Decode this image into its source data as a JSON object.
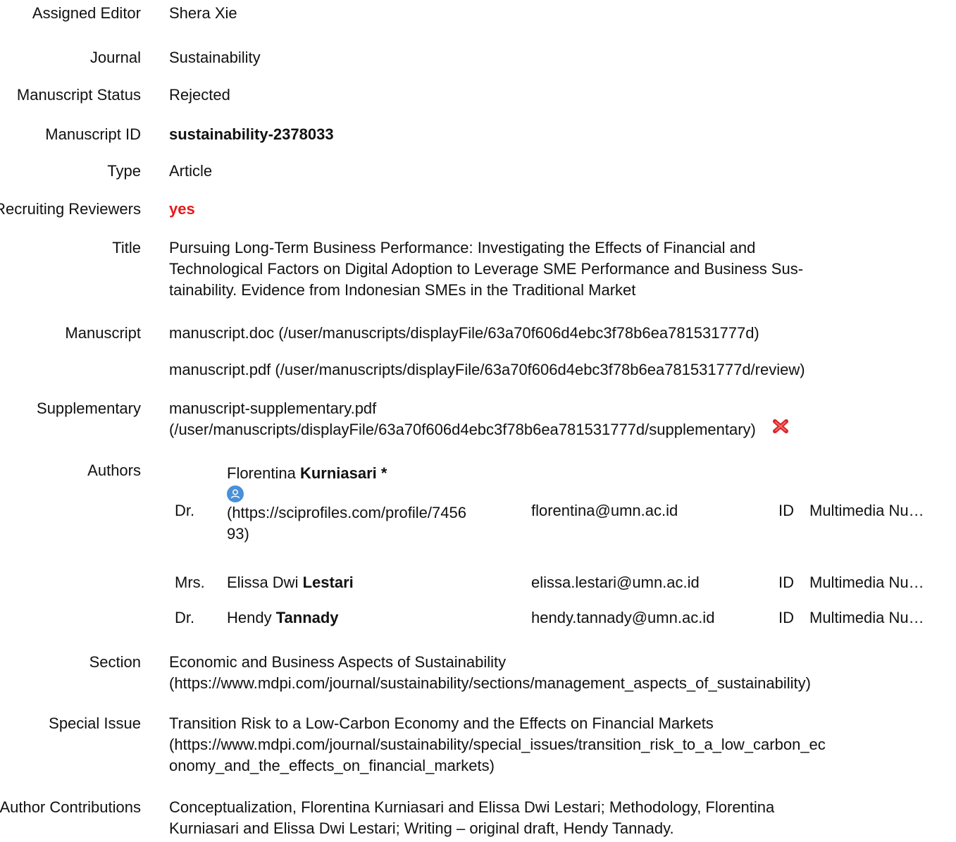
{
  "fields": {
    "assigned_editor": {
      "label": "Assigned Editor",
      "value": "Shera Xie"
    },
    "journal": {
      "label": "Journal",
      "value": "Sustainability"
    },
    "manuscript_status": {
      "label": "Manuscript Status",
      "value": "Rejected"
    },
    "manuscript_id": {
      "label": "Manuscript ID",
      "value": "sustainability-2378033"
    },
    "type": {
      "label": "Type",
      "value": "Article"
    },
    "recruiting_reviewers": {
      "label": "Recruiting Reviewers",
      "value": "yes"
    },
    "title": {
      "label": "Title",
      "lines": [
        "Pursuing Long-Term Business Performance: Investigating the Effects of Financial and",
        "Technological Factors on Digital Adoption to Leverage SME Performance and Business Sus-",
        "tainability. Evidence from Indonesian SMEs in the Traditional Market"
      ]
    },
    "manuscript": {
      "label": "Manuscript",
      "files": [
        "manuscript.doc (/user/manuscripts/displayFile/63a70f606d4ebc3f78b6ea781531777d)",
        "manuscript.pdf (/user/manuscripts/displayFile/63a70f606d4ebc3f78b6ea781531777d/review)"
      ]
    },
    "supplementary": {
      "label": "Supplementary",
      "line1": "manuscript-supplementary.pdf",
      "line2": "(/user/manuscripts/displayFile/63a70f606d4ebc3f78b6ea781531777d/supplementary)",
      "delete_icon": "red-x-icon"
    },
    "authors": {
      "label": "Authors",
      "rows": [
        {
          "honorific": "Dr.",
          "first": "Florentina",
          "last": "Kurniasari *",
          "profile_line1": "(https://sciprofiles.com/profile/7456",
          "profile_line2": "93)",
          "email": "florentina@umn.ac.id",
          "country": "ID",
          "affiliation": "Multimedia Nu…"
        },
        {
          "honorific": "Mrs.",
          "first": "Elissa Dwi",
          "last": "Lestari",
          "email": "elissa.lestari@umn.ac.id",
          "country": "ID",
          "affiliation": "Multimedia Nu…"
        },
        {
          "honorific": "Dr.",
          "first": "Hendy",
          "last": "Tannady",
          "email": "hendy.tannady@umn.ac.id",
          "country": "ID",
          "affiliation": "Multimedia Nu…"
        }
      ]
    },
    "section": {
      "label": "Section",
      "line1": "Economic and Business Aspects of Sustainability",
      "line2": "(https://www.mdpi.com/journal/sustainability/sections/management_aspects_of_sustainability)"
    },
    "special_issue": {
      "label": "Special Issue",
      "line1": "Transition Risk to a Low-Carbon Economy and the Effects on Financial Markets",
      "line2": "(https://www.mdpi.com/journal/sustainability/special_issues/transition_risk_to_a_low_carbon_ec",
      "line3": "onomy_and_the_effects_on_financial_markets)"
    },
    "author_contributions": {
      "label": "Author Contributions",
      "line1": "Conceptualization, Florentina Kurniasari and Elissa Dwi Lestari; Methodology, Florentina",
      "line2": "Kurniasari and Elissa Dwi Lestari; Writing – original draft, Hendy Tannady."
    }
  },
  "colors": {
    "text": "#111111",
    "highlight_red": "#e8181a",
    "profile_icon": "#4a90d9",
    "delete_icon": "#d9262a"
  }
}
